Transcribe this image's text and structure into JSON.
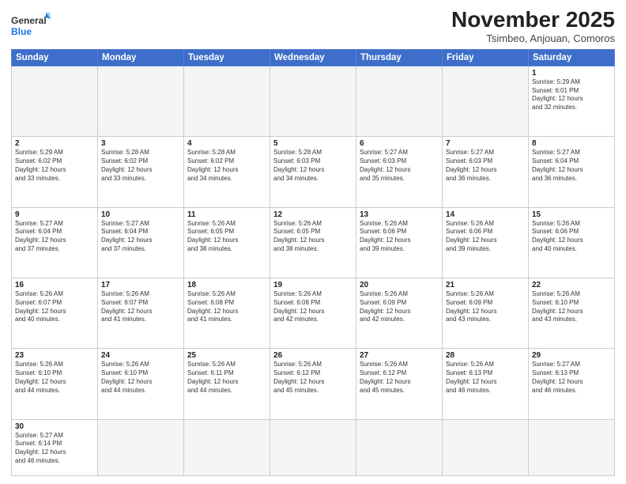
{
  "header": {
    "logo_general": "General",
    "logo_blue": "Blue",
    "title": "November 2025",
    "subtitle": "Tsimbeo, Anjouan, Comoros"
  },
  "days_of_week": [
    "Sunday",
    "Monday",
    "Tuesday",
    "Wednesday",
    "Thursday",
    "Friday",
    "Saturday"
  ],
  "weeks": [
    [
      {
        "day": "",
        "info": ""
      },
      {
        "day": "",
        "info": ""
      },
      {
        "day": "",
        "info": ""
      },
      {
        "day": "",
        "info": ""
      },
      {
        "day": "",
        "info": ""
      },
      {
        "day": "",
        "info": ""
      },
      {
        "day": "1",
        "info": "Sunrise: 5:29 AM\nSunset: 6:01 PM\nDaylight: 12 hours\nand 32 minutes."
      }
    ],
    [
      {
        "day": "2",
        "info": "Sunrise: 5:29 AM\nSunset: 6:02 PM\nDaylight: 12 hours\nand 33 minutes."
      },
      {
        "day": "3",
        "info": "Sunrise: 5:28 AM\nSunset: 6:02 PM\nDaylight: 12 hours\nand 33 minutes."
      },
      {
        "day": "4",
        "info": "Sunrise: 5:28 AM\nSunset: 6:02 PM\nDaylight: 12 hours\nand 34 minutes."
      },
      {
        "day": "5",
        "info": "Sunrise: 5:28 AM\nSunset: 6:03 PM\nDaylight: 12 hours\nand 34 minutes."
      },
      {
        "day": "6",
        "info": "Sunrise: 5:27 AM\nSunset: 6:03 PM\nDaylight: 12 hours\nand 35 minutes."
      },
      {
        "day": "7",
        "info": "Sunrise: 5:27 AM\nSunset: 6:03 PM\nDaylight: 12 hours\nand 36 minutes."
      },
      {
        "day": "8",
        "info": "Sunrise: 5:27 AM\nSunset: 6:04 PM\nDaylight: 12 hours\nand 36 minutes."
      }
    ],
    [
      {
        "day": "9",
        "info": "Sunrise: 5:27 AM\nSunset: 6:04 PM\nDaylight: 12 hours\nand 37 minutes."
      },
      {
        "day": "10",
        "info": "Sunrise: 5:27 AM\nSunset: 6:04 PM\nDaylight: 12 hours\nand 37 minutes."
      },
      {
        "day": "11",
        "info": "Sunrise: 5:26 AM\nSunset: 6:05 PM\nDaylight: 12 hours\nand 38 minutes."
      },
      {
        "day": "12",
        "info": "Sunrise: 5:26 AM\nSunset: 6:05 PM\nDaylight: 12 hours\nand 38 minutes."
      },
      {
        "day": "13",
        "info": "Sunrise: 5:26 AM\nSunset: 6:06 PM\nDaylight: 12 hours\nand 39 minutes."
      },
      {
        "day": "14",
        "info": "Sunrise: 5:26 AM\nSunset: 6:06 PM\nDaylight: 12 hours\nand 39 minutes."
      },
      {
        "day": "15",
        "info": "Sunrise: 5:26 AM\nSunset: 6:06 PM\nDaylight: 12 hours\nand 40 minutes."
      }
    ],
    [
      {
        "day": "16",
        "info": "Sunrise: 5:26 AM\nSunset: 6:07 PM\nDaylight: 12 hours\nand 40 minutes."
      },
      {
        "day": "17",
        "info": "Sunrise: 5:26 AM\nSunset: 6:07 PM\nDaylight: 12 hours\nand 41 minutes."
      },
      {
        "day": "18",
        "info": "Sunrise: 5:26 AM\nSunset: 6:08 PM\nDaylight: 12 hours\nand 41 minutes."
      },
      {
        "day": "19",
        "info": "Sunrise: 5:26 AM\nSunset: 6:08 PM\nDaylight: 12 hours\nand 42 minutes."
      },
      {
        "day": "20",
        "info": "Sunrise: 5:26 AM\nSunset: 6:09 PM\nDaylight: 12 hours\nand 42 minutes."
      },
      {
        "day": "21",
        "info": "Sunrise: 5:26 AM\nSunset: 6:09 PM\nDaylight: 12 hours\nand 43 minutes."
      },
      {
        "day": "22",
        "info": "Sunrise: 5:26 AM\nSunset: 6:10 PM\nDaylight: 12 hours\nand 43 minutes."
      }
    ],
    [
      {
        "day": "23",
        "info": "Sunrise: 5:26 AM\nSunset: 6:10 PM\nDaylight: 12 hours\nand 44 minutes."
      },
      {
        "day": "24",
        "info": "Sunrise: 5:26 AM\nSunset: 6:10 PM\nDaylight: 12 hours\nand 44 minutes."
      },
      {
        "day": "25",
        "info": "Sunrise: 5:26 AM\nSunset: 6:11 PM\nDaylight: 12 hours\nand 44 minutes."
      },
      {
        "day": "26",
        "info": "Sunrise: 5:26 AM\nSunset: 6:12 PM\nDaylight: 12 hours\nand 45 minutes."
      },
      {
        "day": "27",
        "info": "Sunrise: 5:26 AM\nSunset: 6:12 PM\nDaylight: 12 hours\nand 45 minutes."
      },
      {
        "day": "28",
        "info": "Sunrise: 5:26 AM\nSunset: 6:13 PM\nDaylight: 12 hours\nand 46 minutes."
      },
      {
        "day": "29",
        "info": "Sunrise: 5:27 AM\nSunset: 6:13 PM\nDaylight: 12 hours\nand 46 minutes."
      }
    ],
    [
      {
        "day": "30",
        "info": "Sunrise: 5:27 AM\nSunset: 6:14 PM\nDaylight: 12 hours\nand 46 minutes."
      },
      {
        "day": "",
        "info": ""
      },
      {
        "day": "",
        "info": ""
      },
      {
        "day": "",
        "info": ""
      },
      {
        "day": "",
        "info": ""
      },
      {
        "day": "",
        "info": ""
      },
      {
        "day": "",
        "info": ""
      }
    ]
  ]
}
